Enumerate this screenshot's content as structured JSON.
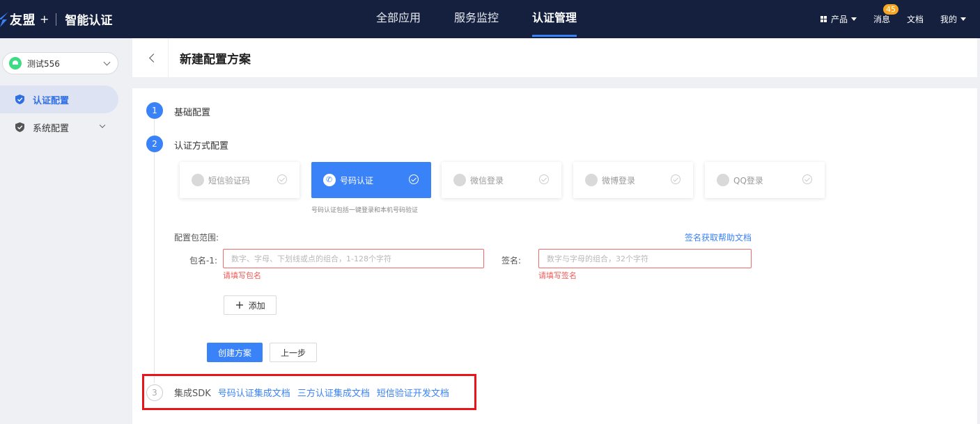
{
  "header": {
    "brand": "友盟",
    "brand_plus": "+",
    "product": "智能认证",
    "nav": [
      "全部应用",
      "服务监控",
      "认证管理"
    ],
    "active_nav": "认证管理",
    "right": {
      "products": "产品",
      "messages": "消息",
      "messages_badge": "45",
      "docs": "文档",
      "mine": "我的"
    },
    "accent_color": "#3a82f7",
    "bg_color": "#14203e"
  },
  "sidebar": {
    "app_select": "测试556",
    "items": [
      {
        "label": "认证配置",
        "icon": "shield-icon",
        "active": true
      },
      {
        "label": "系统配置",
        "icon": "shield-icon",
        "active": false
      }
    ]
  },
  "page": {
    "title": "新建配置方案"
  },
  "steps": [
    {
      "number": "1",
      "label": "基础配置"
    },
    {
      "number": "2",
      "label": "认证方式配置"
    },
    {
      "number": "3",
      "label": "集成SDK"
    }
  ],
  "methods": [
    {
      "label": "短信验证码",
      "icon": "phone-icon",
      "selected": false
    },
    {
      "label": "号码认证",
      "icon": "phone-icon",
      "selected": true
    },
    {
      "label": "微信登录",
      "icon": "wechat-icon",
      "selected": false
    },
    {
      "label": "微博登录",
      "icon": "weibo-icon",
      "selected": false
    },
    {
      "label": "QQ登录",
      "icon": "qq-icon",
      "selected": false
    }
  ],
  "method_hint": "号码认证包括一键登录和本机号码验证",
  "form": {
    "scope_label": "配置包范围:",
    "help_link": "签名获取帮助文档",
    "package_label": "包名-1:",
    "package_placeholder": "数字、字母、下划线或点的组合，1-128个字符",
    "package_error": "请填写包名",
    "signature_label": "签名:",
    "signature_placeholder": "数字与字母的组合，32个字符",
    "signature_error": "请填写签名",
    "add_button": "添加",
    "create_button": "创建方案",
    "prev_button": "上一步"
  },
  "sdk": {
    "links": [
      "号码认证集成文档",
      "三方认证集成文档",
      "短信验证开发文档"
    ]
  }
}
